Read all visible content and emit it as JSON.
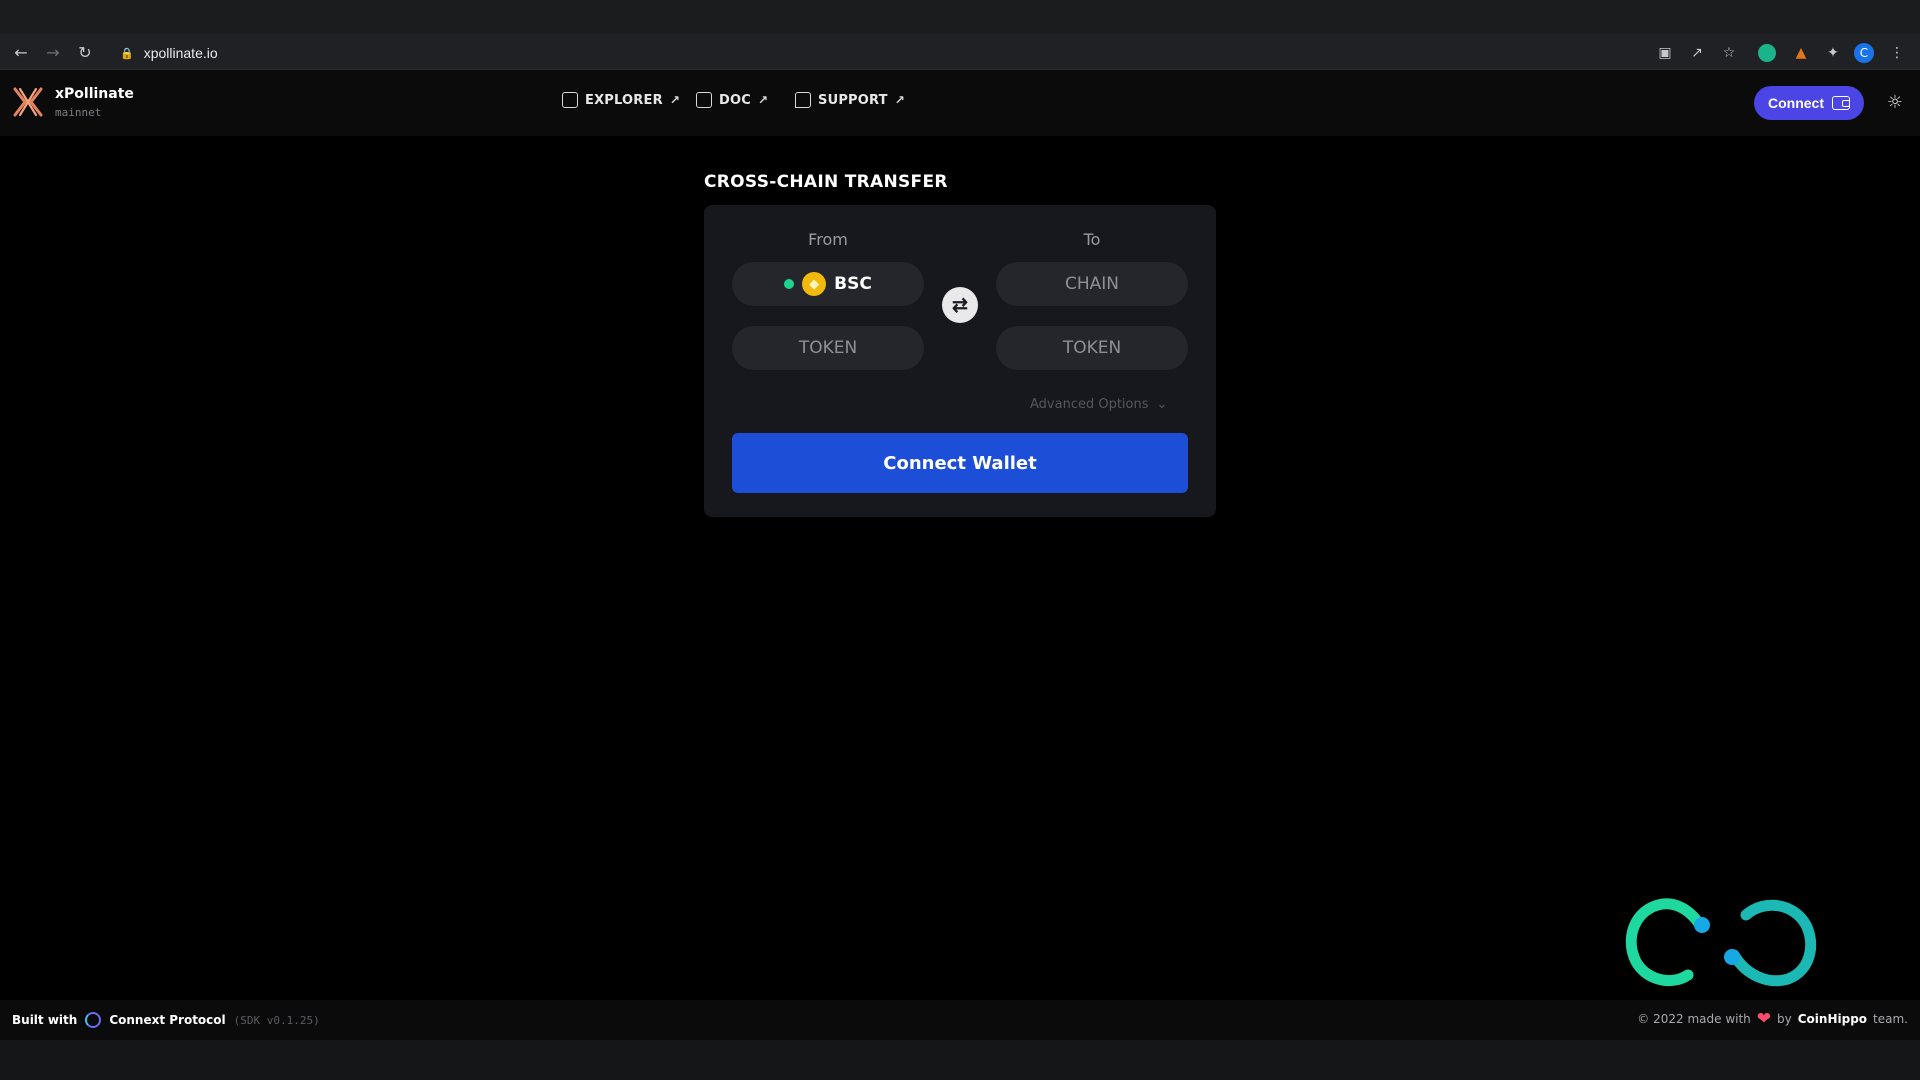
{
  "browser": {
    "url": "xpollinate.io",
    "profile_initial": "C"
  },
  "header": {
    "brand_name": "xPollinate",
    "network": "mainnet",
    "nav": [
      {
        "label": "EXPLORER",
        "icon": "search-doc-icon"
      },
      {
        "label": "DOC",
        "icon": "doc-icon"
      },
      {
        "label": "SUPPORT",
        "icon": "chat-icon"
      }
    ],
    "connect_label": "Connect"
  },
  "transfer": {
    "title": "CROSS-CHAIN TRANSFER",
    "from_label": "From",
    "to_label": "To",
    "from_chain": "BSC",
    "to_chain_placeholder": "CHAIN",
    "from_token_placeholder": "TOKEN",
    "to_token_placeholder": "TOKEN",
    "advanced_options": "Advanced Options",
    "connect_wallet": "Connect Wallet"
  },
  "footer": {
    "built_with": "Built with",
    "protocol": "Connext Protocol",
    "sdk_version": "(SDK v0.1.25)",
    "made_with_prefix": "© 2022 made with",
    "by": "by",
    "team": "CoinHippo",
    "team_suffix": "team."
  },
  "colors": {
    "accent": "#4b45e6",
    "primary_button": "#1d4ed8",
    "card": "#17181d",
    "pill": "#25262c",
    "bsc": "#f0b90b",
    "status_green": "#1ed38e"
  }
}
